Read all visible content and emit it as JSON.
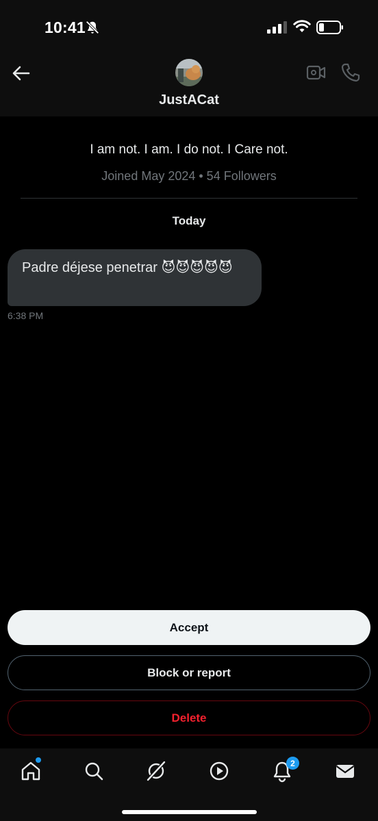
{
  "status_bar": {
    "time": "10:41",
    "icons": [
      "bell-off-icon",
      "signal-icon",
      "wifi-icon",
      "battery-icon"
    ]
  },
  "header": {
    "name": "JustACat",
    "back_icon": "arrow-left-icon",
    "video_icon": "video-call-icon",
    "phone_icon": "phone-icon"
  },
  "profile": {
    "bio": "I am not. I am. I do not. I Care not.",
    "meta": "Joined May 2024 • 54 Followers"
  },
  "conversation": {
    "day_label": "Today",
    "messages": [
      {
        "text": "Padre déjese penetrar 😈😈😈😈😈",
        "time": "6:38 PM"
      }
    ]
  },
  "actions": {
    "accept": "Accept",
    "block_report": "Block or report",
    "delete": "Delete"
  },
  "tab_bar": {
    "tabs": [
      "home-icon",
      "search-icon",
      "grok-icon",
      "video-play-icon",
      "notifications-icon",
      "messages-icon"
    ],
    "notification_count": "2"
  },
  "colors": {
    "accent": "#1d9bf0",
    "danger": "#f4212e",
    "bubble": "#2f3336",
    "muted": "#71767b"
  }
}
